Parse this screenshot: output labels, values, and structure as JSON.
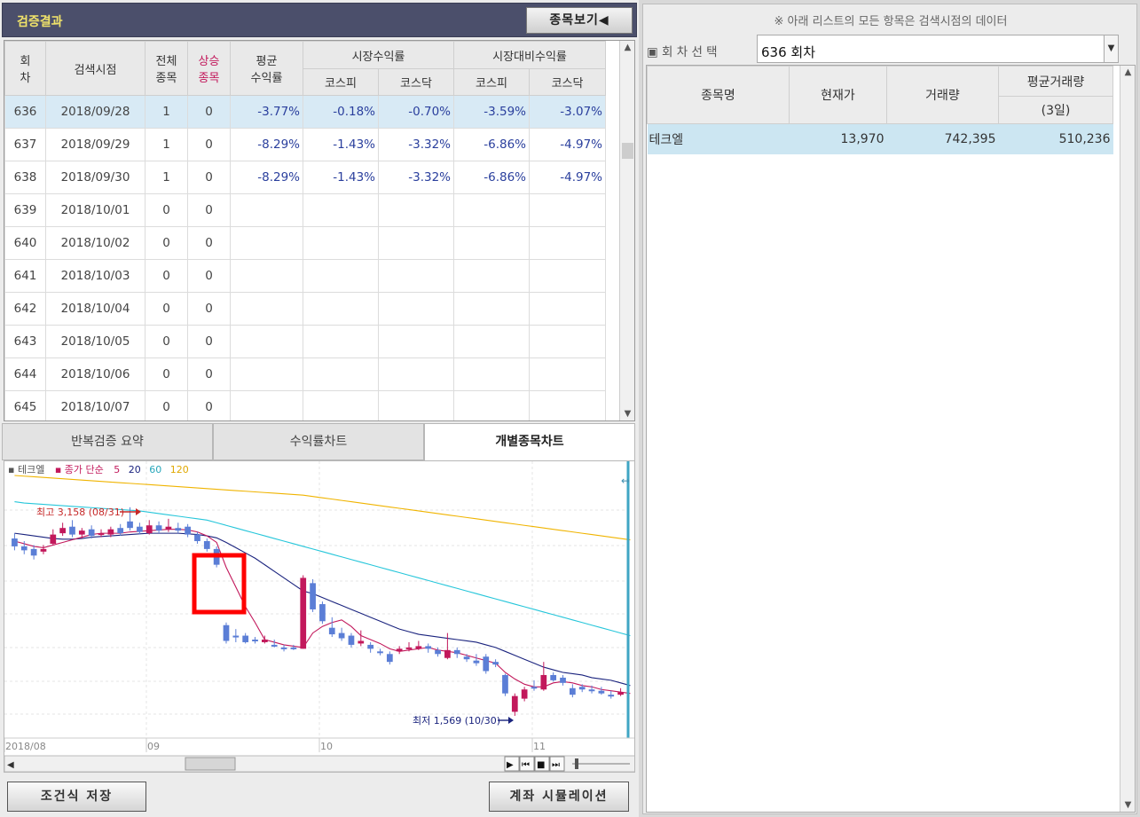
{
  "left": {
    "title": "검증결과",
    "stock_view_button": "종목보기◀",
    "columns": {
      "round": "회\n차",
      "search_time": "검색시점",
      "total": "전체\n종목",
      "rising": "상승\n종목",
      "avg_return": "평균\n수익률",
      "market_return": "시장수익률",
      "vs_market": "시장대비수익률",
      "kospi": "코스피",
      "kosdaq": "코스닥"
    },
    "rows": [
      {
        "round": "636",
        "date": "2018/09/28",
        "total": "1",
        "rising": "0",
        "avg": "-3.77%",
        "mk_kospi": "-0.18%",
        "mk_kosdaq": "-0.70%",
        "vs_kospi": "-3.59%",
        "vs_kosdaq": "-3.07%"
      },
      {
        "round": "637",
        "date": "2018/09/29",
        "total": "1",
        "rising": "0",
        "avg": "-8.29%",
        "mk_kospi": "-1.43%",
        "mk_kosdaq": "-3.32%",
        "vs_kospi": "-6.86%",
        "vs_kosdaq": "-4.97%"
      },
      {
        "round": "638",
        "date": "2018/09/30",
        "total": "1",
        "rising": "0",
        "avg": "-8.29%",
        "mk_kospi": "-1.43%",
        "mk_kosdaq": "-3.32%",
        "vs_kospi": "-6.86%",
        "vs_kosdaq": "-4.97%"
      },
      {
        "round": "639",
        "date": "2018/10/01",
        "total": "0",
        "rising": "0",
        "avg": "",
        "mk_kospi": "",
        "mk_kosdaq": "",
        "vs_kospi": "",
        "vs_kosdaq": ""
      },
      {
        "round": "640",
        "date": "2018/10/02",
        "total": "0",
        "rising": "0",
        "avg": "",
        "mk_kospi": "",
        "mk_kosdaq": "",
        "vs_kospi": "",
        "vs_kosdaq": ""
      },
      {
        "round": "641",
        "date": "2018/10/03",
        "total": "0",
        "rising": "0",
        "avg": "",
        "mk_kospi": "",
        "mk_kosdaq": "",
        "vs_kospi": "",
        "vs_kosdaq": ""
      },
      {
        "round": "642",
        "date": "2018/10/04",
        "total": "0",
        "rising": "0",
        "avg": "",
        "mk_kospi": "",
        "mk_kosdaq": "",
        "vs_kospi": "",
        "vs_kosdaq": ""
      },
      {
        "round": "643",
        "date": "2018/10/05",
        "total": "0",
        "rising": "0",
        "avg": "",
        "mk_kospi": "",
        "mk_kosdaq": "",
        "vs_kospi": "",
        "vs_kosdaq": ""
      },
      {
        "round": "644",
        "date": "2018/10/06",
        "total": "0",
        "rising": "0",
        "avg": "",
        "mk_kospi": "",
        "mk_kosdaq": "",
        "vs_kospi": "",
        "vs_kosdaq": ""
      },
      {
        "round": "645",
        "date": "2018/10/07",
        "total": "0",
        "rising": "0",
        "avg": "",
        "mk_kospi": "",
        "mk_kosdaq": "",
        "vs_kospi": "",
        "vs_kosdaq": ""
      }
    ],
    "tabs": [
      "반복검증 요약",
      "수익률차트",
      "개별종목차트"
    ],
    "active_tab": 2,
    "save_button": "조건식 저장",
    "simulation_button": "계좌 시뮬레이션"
  },
  "chart": {
    "legend_stock": "테크엘",
    "legend_ma_prefix": "종가 단순",
    "legend_ma": [
      "5",
      "20",
      "60",
      "120"
    ],
    "high_label": "최고 3,158 (08/31)",
    "low_label": "최저 1,569 (10/30)",
    "x_labels": [
      "2018/08",
      "09",
      "10",
      "11"
    ],
    "colors": {
      "up": "#c2185b",
      "down": "#5b7ed6",
      "ma5": "#c2185b",
      "ma20": "#1a237e",
      "ma60": "#26c6da",
      "ma120": "#f0b400",
      "highlight": "#ff0000"
    }
  },
  "chart_data": {
    "type": "candlestick",
    "ylim": [
      1400,
      3400
    ],
    "candles": [
      {
        "o": 2920,
        "c": 2860,
        "h": 2960,
        "l": 2830
      },
      {
        "o": 2860,
        "c": 2830,
        "h": 2900,
        "l": 2800
      },
      {
        "o": 2840,
        "c": 2790,
        "h": 2870,
        "l": 2760
      },
      {
        "o": 2820,
        "c": 2840,
        "h": 2870,
        "l": 2800
      },
      {
        "o": 2880,
        "c": 2950,
        "h": 2990,
        "l": 2870
      },
      {
        "o": 2960,
        "c": 3000,
        "h": 3040,
        "l": 2940
      },
      {
        "o": 3010,
        "c": 2950,
        "h": 3060,
        "l": 2930
      },
      {
        "o": 2950,
        "c": 2980,
        "h": 3000,
        "l": 2920
      },
      {
        "o": 2990,
        "c": 2940,
        "h": 3020,
        "l": 2920
      },
      {
        "o": 2950,
        "c": 2960,
        "h": 2990,
        "l": 2930
      },
      {
        "o": 2950,
        "c": 2990,
        "h": 3010,
        "l": 2930
      },
      {
        "o": 3000,
        "c": 2960,
        "h": 3030,
        "l": 2940
      },
      {
        "o": 3050,
        "c": 3000,
        "h": 3158,
        "l": 2980
      },
      {
        "o": 3010,
        "c": 2970,
        "h": 3040,
        "l": 2950
      },
      {
        "o": 2960,
        "c": 3020,
        "h": 3060,
        "l": 2950
      },
      {
        "o": 3020,
        "c": 2980,
        "h": 3050,
        "l": 2960
      },
      {
        "o": 2990,
        "c": 3010,
        "h": 3070,
        "l": 2970
      },
      {
        "o": 3000,
        "c": 2980,
        "h": 3040,
        "l": 2960
      },
      {
        "o": 3010,
        "c": 2950,
        "h": 3030,
        "l": 2930
      },
      {
        "o": 2950,
        "c": 2900,
        "h": 2970,
        "l": 2880
      },
      {
        "o": 2900,
        "c": 2840,
        "h": 2920,
        "l": 2820
      },
      {
        "o": 2840,
        "c": 2720,
        "h": 2860,
        "l": 2700
      },
      {
        "o": 2260,
        "c": 2140,
        "h": 2280,
        "l": 2120
      },
      {
        "o": 2180,
        "c": 2170,
        "h": 2230,
        "l": 2130
      },
      {
        "o": 2180,
        "c": 2130,
        "h": 2200,
        "l": 2120
      },
      {
        "o": 2150,
        "c": 2140,
        "h": 2170,
        "l": 2120
      },
      {
        "o": 2130,
        "c": 2150,
        "h": 2180,
        "l": 2120
      },
      {
        "o": 2110,
        "c": 2100,
        "h": 2150,
        "l": 2090
      },
      {
        "o": 2090,
        "c": 2080,
        "h": 2110,
        "l": 2060
      },
      {
        "o": 2090,
        "c": 2080,
        "h": 2110,
        "l": 2070
      },
      {
        "o": 2080,
        "c": 2620,
        "h": 2640,
        "l": 2080
      },
      {
        "o": 2580,
        "c": 2380,
        "h": 2610,
        "l": 2360
      },
      {
        "o": 2420,
        "c": 2290,
        "h": 2440,
        "l": 2270
      },
      {
        "o": 2240,
        "c": 2190,
        "h": 2320,
        "l": 2170
      },
      {
        "o": 2200,
        "c": 2160,
        "h": 2240,
        "l": 2140
      },
      {
        "o": 2180,
        "c": 2110,
        "h": 2200,
        "l": 2090
      },
      {
        "o": 2120,
        "c": 2140,
        "h": 2220,
        "l": 2100
      },
      {
        "o": 2110,
        "c": 2080,
        "h": 2130,
        "l": 2050
      },
      {
        "o": 2060,
        "c": 2050,
        "h": 2080,
        "l": 2030
      },
      {
        "o": 2040,
        "c": 1980,
        "h": 2060,
        "l": 1960
      },
      {
        "o": 2060,
        "c": 2080,
        "h": 2100,
        "l": 2040
      },
      {
        "o": 2080,
        "c": 2090,
        "h": 2130,
        "l": 2060
      },
      {
        "o": 2080,
        "c": 2100,
        "h": 2140,
        "l": 2070
      },
      {
        "o": 2100,
        "c": 2080,
        "h": 2120,
        "l": 2050
      },
      {
        "o": 2070,
        "c": 2040,
        "h": 2090,
        "l": 2020
      },
      {
        "o": 2010,
        "c": 2070,
        "h": 2200,
        "l": 2000
      },
      {
        "o": 2070,
        "c": 2040,
        "h": 2090,
        "l": 2010
      },
      {
        "o": 2020,
        "c": 2000,
        "h": 2040,
        "l": 1980
      },
      {
        "o": 1990,
        "c": 1970,
        "h": 2040,
        "l": 1950
      },
      {
        "o": 2020,
        "c": 1910,
        "h": 2040,
        "l": 1890
      },
      {
        "o": 1980,
        "c": 1960,
        "h": 2000,
        "l": 1940
      },
      {
        "o": 1880,
        "c": 1740,
        "h": 1890,
        "l": 1720
      },
      {
        "o": 1600,
        "c": 1720,
        "h": 1740,
        "l": 1569
      },
      {
        "o": 1700,
        "c": 1770,
        "h": 1790,
        "l": 1680
      },
      {
        "o": 1790,
        "c": 1780,
        "h": 1840,
        "l": 1760
      },
      {
        "o": 1770,
        "c": 1880,
        "h": 1980,
        "l": 1760
      },
      {
        "o": 1880,
        "c": 1840,
        "h": 1900,
        "l": 1830
      },
      {
        "o": 1860,
        "c": 1820,
        "h": 1880,
        "l": 1800
      },
      {
        "o": 1780,
        "c": 1730,
        "h": 1810,
        "l": 1710
      },
      {
        "o": 1790,
        "c": 1770,
        "h": 1810,
        "l": 1750
      },
      {
        "o": 1770,
        "c": 1760,
        "h": 1800,
        "l": 1740
      },
      {
        "o": 1760,
        "c": 1740,
        "h": 1790,
        "l": 1730
      },
      {
        "o": 1730,
        "c": 1720,
        "h": 1760,
        "l": 1700
      },
      {
        "o": 1730,
        "c": 1750,
        "h": 1780,
        "l": 1720
      }
    ],
    "ma5": [
      2900,
      2880,
      2860,
      2850,
      2870,
      2890,
      2910,
      2930,
      2950,
      2960,
      2960,
      2960,
      2970,
      2975,
      2980,
      2985,
      2990,
      2990,
      2985,
      2970,
      2940,
      2890,
      2700,
      2550,
      2400,
      2280,
      2150,
      2130,
      2110,
      2100,
      2090,
      2200,
      2250,
      2280,
      2300,
      2250,
      2180,
      2150,
      2120,
      2080,
      2060,
      2070,
      2080,
      2090,
      2070,
      2060,
      2050,
      2030,
      2010,
      1990,
      1970,
      1900,
      1850,
      1810,
      1790,
      1790,
      1820,
      1830,
      1820,
      1800,
      1790,
      1770,
      1760,
      1750,
      1740
    ],
    "ma20": [
      2960,
      2950,
      2940,
      2930,
      2920,
      2915,
      2915,
      2920,
      2930,
      2935,
      2940,
      2945,
      2950,
      2955,
      2960,
      2960,
      2960,
      2960,
      2955,
      2950,
      2940,
      2925,
      2890,
      2850,
      2810,
      2770,
      2720,
      2670,
      2620,
      2570,
      2520,
      2500,
      2470,
      2440,
      2410,
      2380,
      2350,
      2320,
      2290,
      2260,
      2230,
      2210,
      2190,
      2180,
      2170,
      2160,
      2150,
      2140,
      2130,
      2110,
      2090,
      2060,
      2030,
      2000,
      1970,
      1940,
      1920,
      1900,
      1890,
      1880,
      1860,
      1850,
      1840,
      1820,
      1800
    ],
    "ma60": [
      3200,
      3190,
      3185,
      3180,
      3175,
      3170,
      3165,
      3160,
      3155,
      3150,
      3145,
      3140,
      3135,
      3130,
      3120,
      3110,
      3100,
      3090,
      3080,
      3070,
      3060,
      3040,
      3020,
      3000,
      2980,
      2960,
      2940,
      2920,
      2900,
      2880,
      2860,
      2840,
      2820,
      2800,
      2780,
      2760,
      2740,
      2720,
      2700,
      2680,
      2660,
      2640,
      2620,
      2600,
      2580,
      2560,
      2540,
      2520,
      2500,
      2480,
      2460,
      2440,
      2420,
      2400,
      2380,
      2360,
      2340,
      2320,
      2300,
      2280,
      2260,
      2240,
      2220,
      2200,
      2180
    ],
    "ma120": [
      3400,
      3395,
      3390,
      3385,
      3380,
      3375,
      3370,
      3365,
      3360,
      3355,
      3350,
      3345,
      3340,
      3335,
      3330,
      3325,
      3320,
      3315,
      3310,
      3305,
      3300,
      3295,
      3290,
      3285,
      3280,
      3275,
      3270,
      3265,
      3260,
      3255,
      3250,
      3240,
      3230,
      3220,
      3210,
      3200,
      3190,
      3180,
      3170,
      3160,
      3150,
      3140,
      3130,
      3120,
      3110,
      3100,
      3090,
      3080,
      3070,
      3060,
      3050,
      3040,
      3030,
      3020,
      3010,
      3000,
      2990,
      2980,
      2970,
      2960,
      2950,
      2940,
      2930,
      2920,
      2910
    ]
  },
  "right": {
    "notice": "※ 아래 리스트의 모든 항목은 검색시점의 데이터",
    "round_label": "▣ 회 차 선 택",
    "round_value": "636 회차",
    "columns": {
      "name": "종목명",
      "price": "현재가",
      "volume": "거래량",
      "avg_volume": "평균거래량",
      "avg_period": "(3일)"
    },
    "rows": [
      {
        "name": "테크엘",
        "price": "13,970",
        "volume": "742,395",
        "avg_volume": "510,236"
      }
    ]
  }
}
